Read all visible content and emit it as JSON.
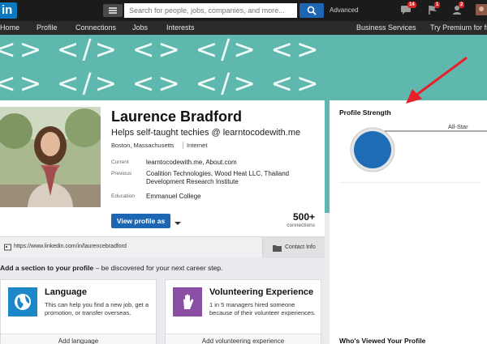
{
  "topbar": {
    "logo": "in",
    "search_placeholder": "Search for people, jobs, companies, and more...",
    "advanced": "Advanced",
    "badges": {
      "messages": "14",
      "notifications": "1",
      "connections": "2"
    }
  },
  "nav": {
    "items": [
      "Home",
      "Profile",
      "Connections",
      "Jobs",
      "Interests"
    ],
    "business": "Business Services",
    "premium": "Try Premium for free"
  },
  "banner": {
    "pattern": "<> </> <> </> <> </> <> </> <> </>"
  },
  "profile": {
    "name": "Laurence Bradford",
    "headline": "Helps self-taught techies @ learntocodewith.me",
    "location": "Boston, Massachusetts",
    "industry": "Internet",
    "current_label": "Current",
    "current_value": "learntocodewith.me, About.com",
    "previous_label": "Previous",
    "previous_value_1": "Coalition Technologies, Wood Heat LLC, Thailand",
    "previous_value_2": "Development Research Institute",
    "education_label": "Education",
    "education_value": "Emmanuel College",
    "view_button": "View profile as",
    "connections_count": "500+",
    "connections_label": "connections",
    "public_url": "https://www.linkedin.com/in/laurencebradford",
    "contact_info": "Contact Info"
  },
  "add_section": {
    "heading_bold": "Add a section to your profile",
    "heading_rest": " – be discovered for your next career step.",
    "language": {
      "title": "Language",
      "desc": "This can help you find a new job, get a promotion, or transfer overseas.",
      "action": "Add language"
    },
    "volunteering": {
      "title": "Volunteering Experience",
      "desc": "1 in 5 managers hired someone because of their volunteer experiences.",
      "action": "Add volunteering experience"
    }
  },
  "right_panel": {
    "profile_strength": "Profile Strength",
    "level": "All-Star",
    "whos_viewed": "Who's Viewed Your Profile"
  },
  "colors": {
    "accent": "#1d66b4",
    "banner": "#5fb8ad",
    "arrow": "#e8202a"
  }
}
